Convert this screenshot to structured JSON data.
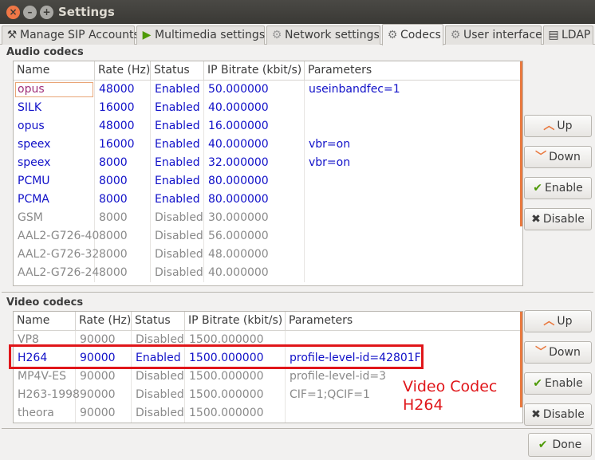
{
  "window": {
    "title": "Settings"
  },
  "tabs": [
    {
      "label": "Manage SIP Accounts",
      "icon": "tools-icon"
    },
    {
      "label": "Multimedia settings",
      "icon": "play-icon"
    },
    {
      "label": "Network settings",
      "icon": "network-gear-icon"
    },
    {
      "label": "Codecs",
      "icon": "codec-icon"
    },
    {
      "label": "User interface",
      "icon": "gear-icon"
    },
    {
      "label": "LDAP",
      "icon": "book-icon"
    }
  ],
  "audio": {
    "title": "Audio codecs",
    "columns": [
      "Name",
      "Rate (Hz)",
      "Status",
      "IP Bitrate (kbit/s)",
      "Parameters"
    ],
    "rows": [
      {
        "name": "opus",
        "rate": "48000",
        "status": "Enabled",
        "bitrate": "50.000000",
        "params": "useinbandfec=1"
      },
      {
        "name": "SILK",
        "rate": "16000",
        "status": "Enabled",
        "bitrate": "40.000000",
        "params": ""
      },
      {
        "name": "opus",
        "rate": "48000",
        "status": "Enabled",
        "bitrate": "16.000000",
        "params": ""
      },
      {
        "name": "speex",
        "rate": "16000",
        "status": "Enabled",
        "bitrate": "40.000000",
        "params": "vbr=on"
      },
      {
        "name": "speex",
        "rate": "8000",
        "status": "Enabled",
        "bitrate": "32.000000",
        "params": "vbr=on"
      },
      {
        "name": "PCMU",
        "rate": "8000",
        "status": "Enabled",
        "bitrate": "80.000000",
        "params": ""
      },
      {
        "name": "PCMA",
        "rate": "8000",
        "status": "Enabled",
        "bitrate": "80.000000",
        "params": ""
      },
      {
        "name": "GSM",
        "rate": "8000",
        "status": "Disabled",
        "bitrate": "30.000000",
        "params": ""
      },
      {
        "name": "AAL2-G726-40",
        "rate": "8000",
        "status": "Disabled",
        "bitrate": "56.000000",
        "params": ""
      },
      {
        "name": "AAL2-G726-32",
        "rate": "8000",
        "status": "Disabled",
        "bitrate": "48.000000",
        "params": ""
      },
      {
        "name": "AAL2-G726-24",
        "rate": "8000",
        "status": "Disabled",
        "bitrate": "40.000000",
        "params": ""
      }
    ]
  },
  "video": {
    "title": "Video codecs",
    "columns": [
      "Name",
      "Rate (Hz)",
      "Status",
      "IP Bitrate (kbit/s)",
      "Parameters"
    ],
    "rows": [
      {
        "name": "VP8",
        "rate": "90000",
        "status": "Disabled",
        "bitrate": "1500.000000",
        "params": ""
      },
      {
        "name": "H264",
        "rate": "90000",
        "status": "Enabled",
        "bitrate": "1500.000000",
        "params": "profile-level-id=42801F"
      },
      {
        "name": "MP4V-ES",
        "rate": "90000",
        "status": "Disabled",
        "bitrate": "1500.000000",
        "params": "profile-level-id=3"
      },
      {
        "name": "H263-1998",
        "rate": "90000",
        "status": "Disabled",
        "bitrate": "1500.000000",
        "params": "CIF=1;QCIF=1"
      },
      {
        "name": "theora",
        "rate": "90000",
        "status": "Disabled",
        "bitrate": "1500.000000",
        "params": ""
      }
    ]
  },
  "buttons": {
    "up": "Up",
    "down": "Down",
    "enable": "Enable",
    "disable": "Disable",
    "done": "Done"
  },
  "annotation": {
    "line1": "Video Codec",
    "line2": "H264"
  },
  "colors": {
    "enabled_text": "#1010c8",
    "disabled_text": "#8a8a8a",
    "highlight": "#e0161a",
    "accent": "#e9793f"
  }
}
